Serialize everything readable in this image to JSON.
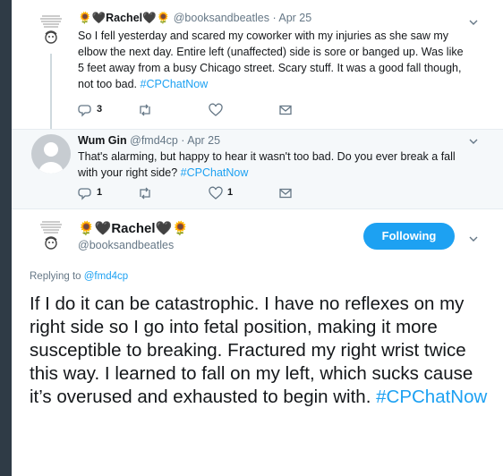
{
  "tweets": [
    {
      "name": "🌻🖤Rachel🖤🌻",
      "handle": "@booksandbeatles",
      "date": "· Apr 25",
      "text": "So I fell yesterday and scared my coworker with my injuries as she saw my elbow the next day. Entire left (unaffected) side is sore or banged up. Was like 5 feet away from a busy Chicago street. Scary stuff. It was a good fall though, not too bad.",
      "hashtag": "#CPChatNow",
      "reply_count": "3",
      "retweet_count": "",
      "like_count": ""
    },
    {
      "name": "Wum Gin",
      "handle": "@fmd4cp",
      "date": "· Apr 25",
      "text": "That's alarming, but happy to hear it wasn't too bad. Do you ever break a fall with your right side?",
      "hashtag": "#CPChatNow",
      "reply_count": "1",
      "retweet_count": "",
      "like_count": "1"
    }
  ],
  "main_tweet": {
    "name": "🌻🖤Rachel🖤🌻",
    "handle": "@booksandbeatles",
    "follow_label": "Following",
    "replying_prefix": "Replying to",
    "replying_to": "@fmd4cp",
    "text": "If I do it can be catastrophic. I have no reflexes on my right side so I go into fetal position, making it more susceptible to breaking. Fractured my right wrist twice this way. I learned to fall on my left, which sucks cause it’s overused and exhausted to begin with.",
    "hashtag": "#CPChatNow"
  },
  "icons": {
    "reply": "reply-icon",
    "retweet": "retweet-icon",
    "like": "heart-icon",
    "message": "envelope-icon",
    "more": "chevron-down-icon"
  },
  "colors": {
    "link": "#1da1f2",
    "follow_button": "#1da1f2",
    "background_dark": "#2f3b46",
    "reply_bg": "#f5f8fa"
  }
}
